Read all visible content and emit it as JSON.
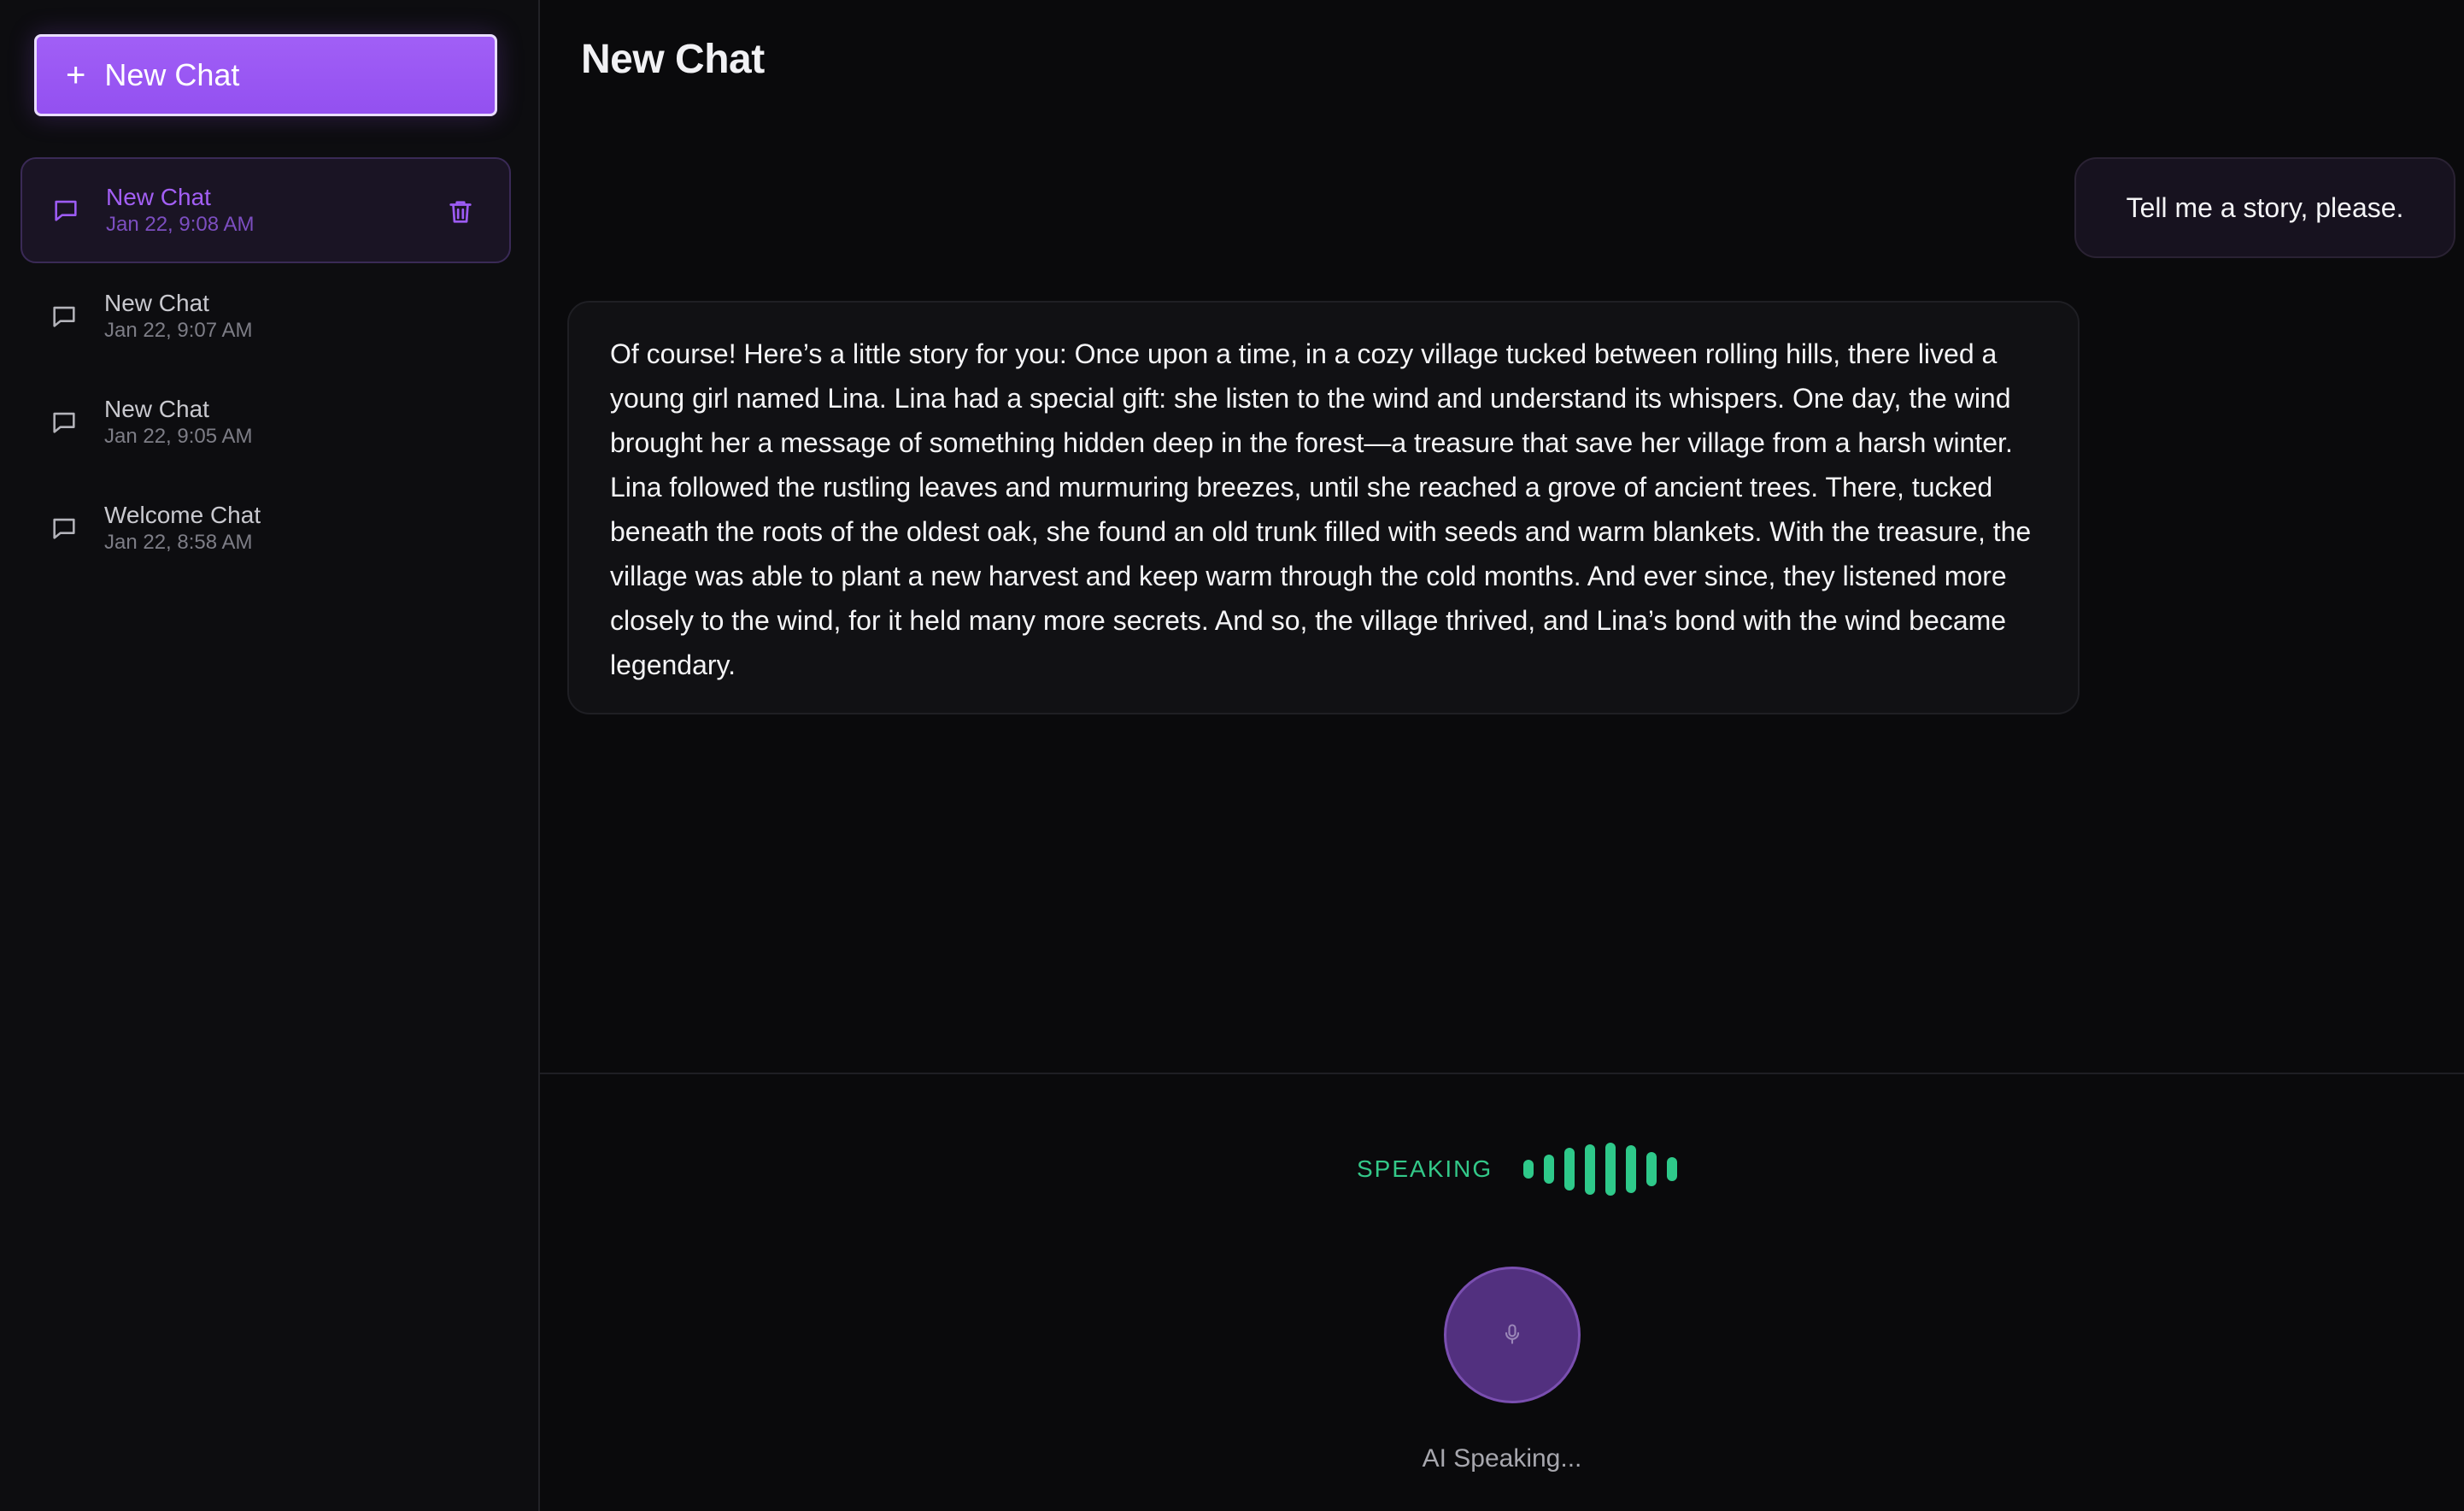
{
  "sidebar": {
    "new_chat_label": "New Chat",
    "items": [
      {
        "title": "New Chat",
        "date": "Jan 22, 9:08 AM",
        "active": true
      },
      {
        "title": "New Chat",
        "date": "Jan 22, 9:07 AM",
        "active": false
      },
      {
        "title": "New Chat",
        "date": "Jan 22, 9:05 AM",
        "active": false
      },
      {
        "title": "Welcome Chat",
        "date": "Jan 22, 8:58 AM",
        "active": false
      }
    ]
  },
  "main": {
    "title": "New Chat",
    "messages": [
      {
        "role": "user",
        "text": "Tell me a story, please."
      },
      {
        "role": "assistant",
        "text": "Of course! Here’s a little story for you: Once upon a time, in a cozy village tucked between rolling hills, there lived a young girl named Lina. Lina had a special gift: she listen to the wind and understand its whispers. One day, the wind brought her a message of something hidden deep in the forest—a treasure that save her village from a harsh winter. Lina followed the rustling leaves and murmuring breezes, until she reached a grove of ancient trees. There, tucked beneath the roots of the oldest oak, she found an old trunk filled with seeds and warm blankets. With the treasure, the village was able to plant a new harvest and keep warm through the cold months. And ever since, they listened more closely to the wind, for it held many more secrets. And so, the village thrived, and Lina’s bond with the wind became legendary."
      }
    ]
  },
  "voice": {
    "speaking_label": "SPEAKING",
    "status_text": "AI Speaking...",
    "mic_icon": "microphone-icon",
    "levels": [
      0.35,
      0.55,
      0.8,
      0.95,
      1.0,
      0.9,
      0.65,
      0.45
    ]
  },
  "colors": {
    "accent": "#9d5cf5",
    "speaking": "#2ec98a",
    "background": "#0a0a0c"
  }
}
